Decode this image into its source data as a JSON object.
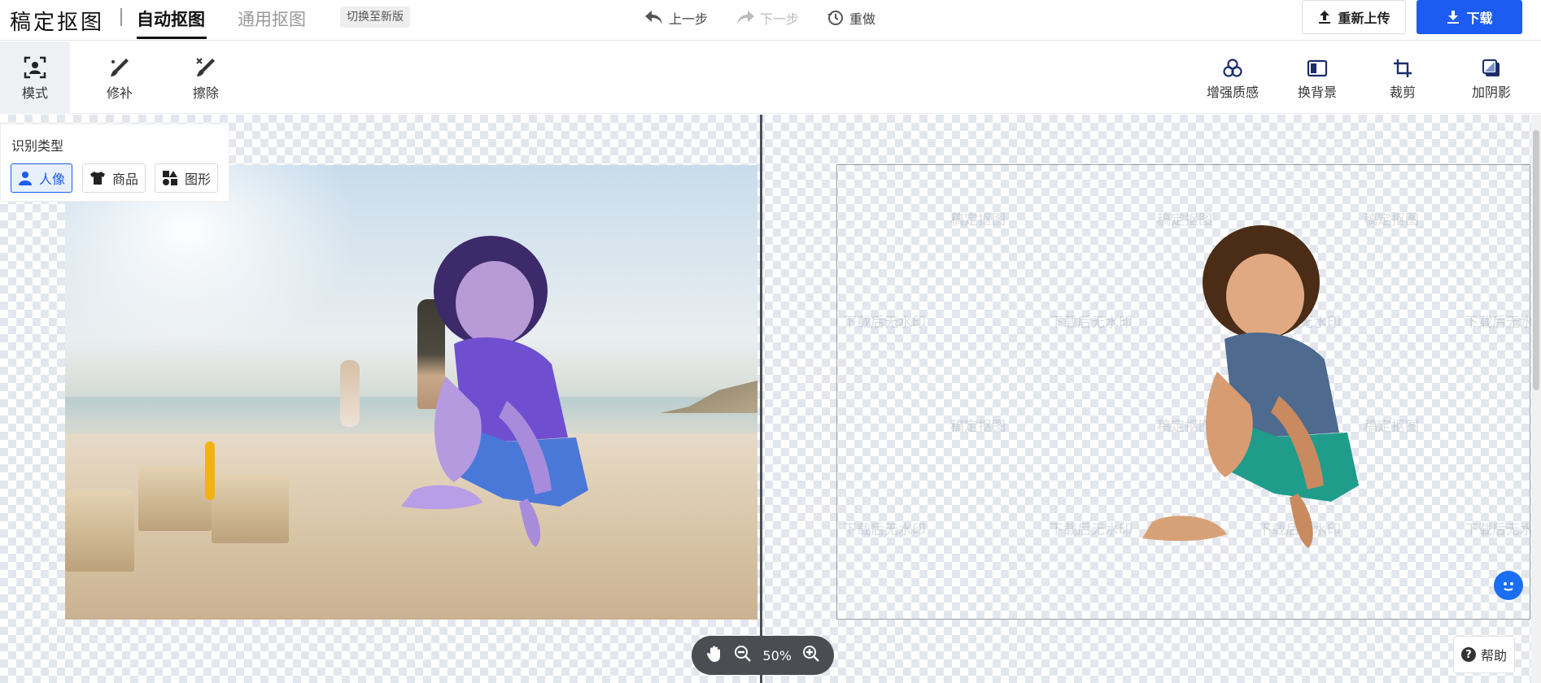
{
  "header": {
    "logo": "稿定抠图",
    "tab_active": "自动抠图",
    "tab_general": "通用抠图",
    "switch_label": "切换至新版",
    "undo_label": "上一步",
    "redo_label": "下一步",
    "reset_label": "重做",
    "reupload_label": "重新上传",
    "download_label": "下载"
  },
  "toolbar": {
    "left_tools": [
      {
        "label": "模式",
        "icon": "person-frame-icon",
        "active": true
      },
      {
        "label": "修补",
        "icon": "brush-repair-icon",
        "active": false
      },
      {
        "label": "擦除",
        "icon": "eraser-icon",
        "active": false
      }
    ],
    "right_tools": [
      {
        "label": "增强质感",
        "icon": "enhance-icon"
      },
      {
        "label": "换背景",
        "icon": "background-icon"
      },
      {
        "label": "裁剪",
        "icon": "crop-icon"
      },
      {
        "label": "加阴影",
        "icon": "shadow-icon"
      }
    ]
  },
  "recognition_panel": {
    "title": "识别类型",
    "types": [
      {
        "label": "人像",
        "icon": "person-icon",
        "active": true
      },
      {
        "label": "商品",
        "icon": "shirt-icon",
        "active": false
      },
      {
        "label": "图形",
        "icon": "shapes-icon",
        "active": false
      }
    ]
  },
  "watermark_text": [
    "稿定抠图",
    "下载后无水印"
  ],
  "zoom": {
    "level": "50%"
  },
  "help_label": "帮助",
  "colors": {
    "accent": "#1c5cf0",
    "active_tool_bg": "#eef0f4",
    "zoom_bar_bg": "#4a4d52"
  }
}
